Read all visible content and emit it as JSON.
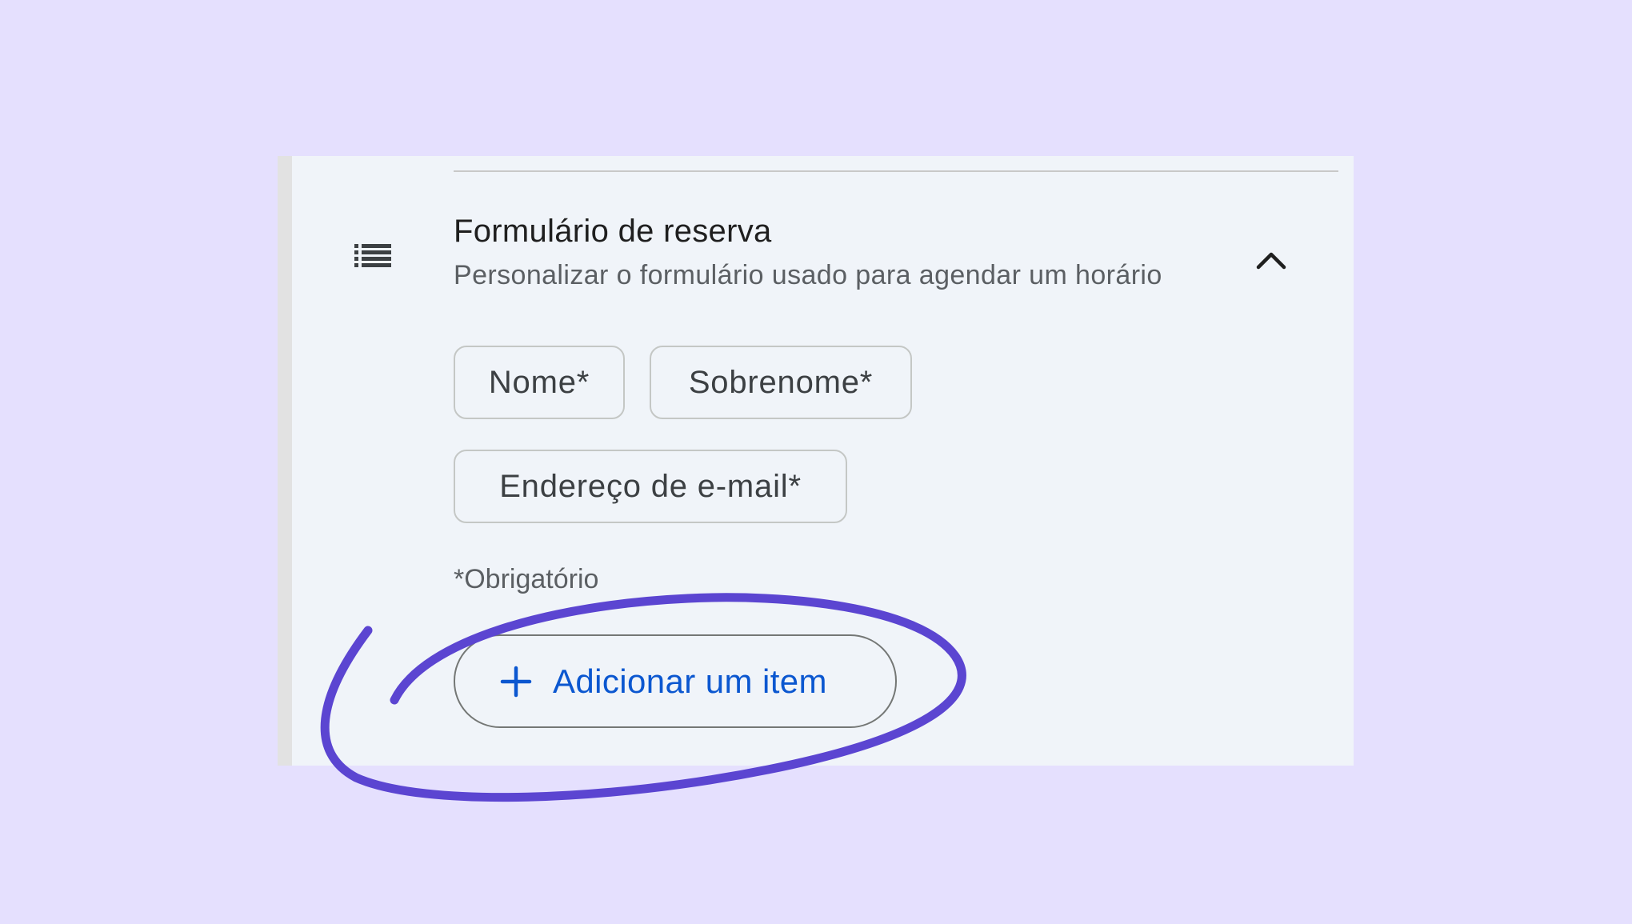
{
  "section": {
    "title": "Formulário de reserva",
    "subtitle": "Personalizar o formulário usado para agendar um horário",
    "icon": "list-icon",
    "collapse_icon": "chevron-up-icon"
  },
  "fields": [
    {
      "label": "Nome*"
    },
    {
      "label": "Sobrenome*"
    },
    {
      "label": "Endereço de e-mail*"
    }
  ],
  "required_note": "*Obrigatório",
  "add_button": {
    "icon": "plus-icon",
    "label": "Adicionar um item"
  },
  "colors": {
    "background": "#e5e0fe",
    "panel": "#f0f4f9",
    "accent_blue": "#0b57d0",
    "annotation_stroke": "#5b45d1"
  }
}
